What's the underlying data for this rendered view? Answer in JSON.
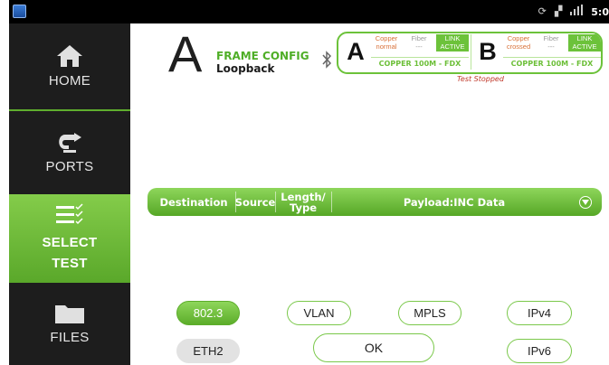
{
  "status_bar": {
    "time": "5:0"
  },
  "sidebar": {
    "items": [
      {
        "label": "HOME",
        "icon": "home-icon"
      },
      {
        "label": "PORTS",
        "icon": "ports-icon"
      },
      {
        "label_line1": "SELECT",
        "label_line2": "TEST",
        "icon": "select-test-icon",
        "active": true
      },
      {
        "label": "FILES",
        "icon": "folder-icon"
      }
    ]
  },
  "header": {
    "port_letter": "A",
    "title": "FRAME CONFIG",
    "subtitle": "Loopback"
  },
  "ports": {
    "a": {
      "letter": "A",
      "copper": "Copper normal",
      "copper_l1": "Copper",
      "copper_l2": "normal",
      "fiber_l1": "Fiber",
      "fiber_l2": "---",
      "link_l1": "LINK",
      "link_l2": "ACTIVE",
      "speed": "COPPER 100M  - FDX"
    },
    "b": {
      "letter": "B",
      "copper_l1": "Copper",
      "copper_l2": "crossed",
      "fiber_l1": "Fiber",
      "fiber_l2": "---",
      "link_l1": "LINK",
      "link_l2": "ACTIVE",
      "speed": "COPPER 100M  - FDX"
    },
    "test_status": "Test Stopped"
  },
  "frame_bar": {
    "destination": "Destination",
    "source": "Source",
    "length_l1": "Length/",
    "length_l2": "Type",
    "payload": "Payload:INC Data"
  },
  "frame_types": {
    "ieee_8023": "802.3",
    "eth2": "ETH2",
    "vlan": "VLAN",
    "mpls": "MPLS",
    "ipv4": "IPv4",
    "ipv6": "IPv6",
    "ok": "OK"
  },
  "colors": {
    "accent_green": "#6cc23a",
    "sidebar_bg": "#1d1d1d",
    "status_red": "#c0392b"
  }
}
